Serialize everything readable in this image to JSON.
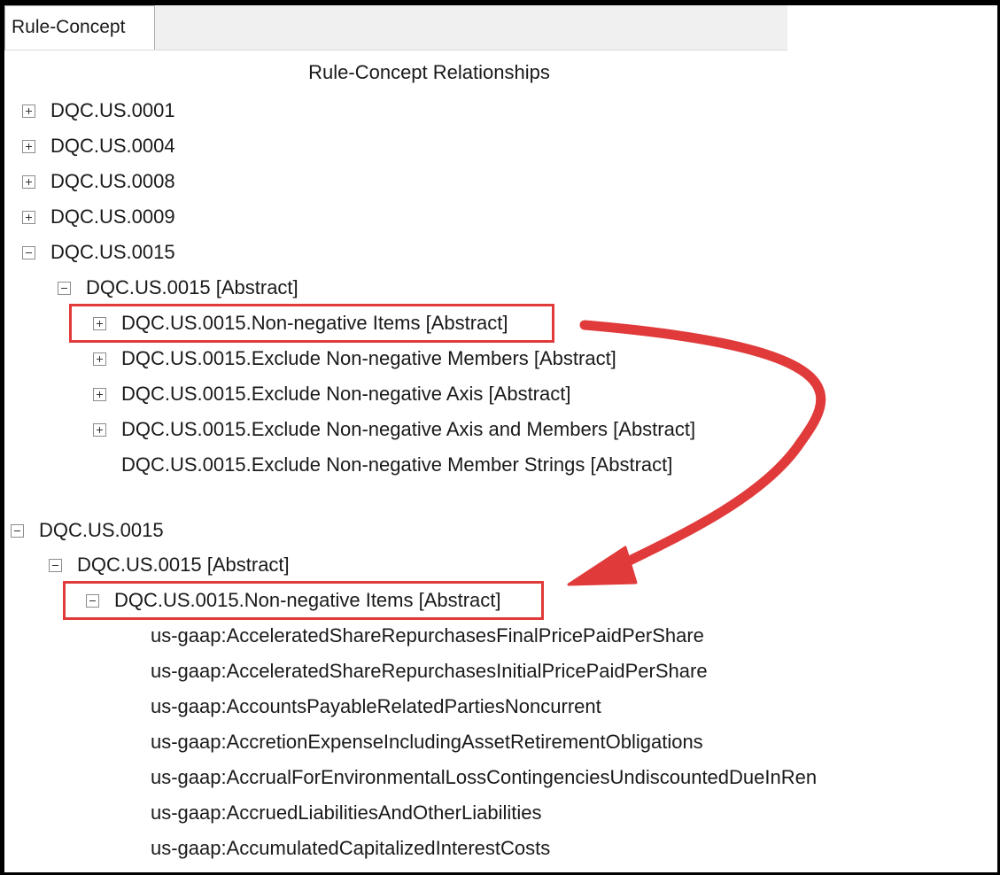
{
  "tab": {
    "label": "Rule-Concept"
  },
  "panel": {
    "title": "Rule-Concept Relationships"
  },
  "tree_top": {
    "items": [
      {
        "label": "DQC.US.0001",
        "state": "collapsed"
      },
      {
        "label": "DQC.US.0004",
        "state": "collapsed"
      },
      {
        "label": "DQC.US.0008",
        "state": "collapsed"
      },
      {
        "label": "DQC.US.0009",
        "state": "collapsed"
      },
      {
        "label": "DQC.US.0015",
        "state": "expanded"
      },
      {
        "label": "DQC.US.0015 [Abstract]",
        "state": "expanded"
      },
      {
        "label": "DQC.US.0015.Non-negative Items [Abstract]",
        "state": "collapsed"
      },
      {
        "label": "DQC.US.0015.Exclude Non-negative Members [Abstract]",
        "state": "collapsed"
      },
      {
        "label": "DQC.US.0015.Exclude Non-negative Axis [Abstract]",
        "state": "collapsed"
      },
      {
        "label": "DQC.US.0015.Exclude Non-negative Axis and Members [Abstract]",
        "state": "collapsed"
      },
      {
        "label": "DQC.US.0015.Exclude Non-negative Member Strings [Abstract]",
        "state": "leaf"
      }
    ]
  },
  "tree_bottom": {
    "items": [
      {
        "label": "DQC.US.0015",
        "state": "expanded"
      },
      {
        "label": "DQC.US.0015 [Abstract]",
        "state": "expanded"
      },
      {
        "label": "DQC.US.0015.Non-negative Items [Abstract]",
        "state": "expanded"
      },
      {
        "label": "us-gaap:AcceleratedShareRepurchasesFinalPricePaidPerShare",
        "state": "leaf"
      },
      {
        "label": "us-gaap:AcceleratedShareRepurchasesInitialPricePaidPerShare",
        "state": "leaf"
      },
      {
        "label": "us-gaap:AccountsPayableRelatedPartiesNoncurrent",
        "state": "leaf"
      },
      {
        "label": "us-gaap:AccretionExpenseIncludingAssetRetirementObligations",
        "state": "leaf"
      },
      {
        "label": "us-gaap:AccrualForEnvironmentalLossContingenciesUndiscountedDueInRen",
        "state": "leaf"
      },
      {
        "label": "us-gaap:AccruedLiabilitiesAndOtherLiabilities",
        "state": "leaf"
      },
      {
        "label": "us-gaap:AccumulatedCapitalizedInterestCosts",
        "state": "leaf"
      }
    ]
  },
  "icons": {
    "expand": "plus-box-icon",
    "collapse": "minus-box-icon"
  },
  "colors": {
    "highlight": "#e03a3a",
    "frame": "#000000"
  }
}
